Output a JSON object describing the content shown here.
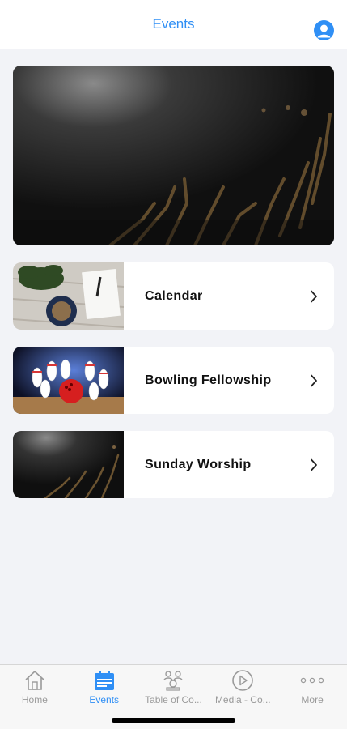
{
  "header": {
    "title": "Events",
    "profile_icon": "user-circle-icon"
  },
  "events": [
    {
      "label": "Calendar",
      "thumb_icon": "calendar-desk-photo"
    },
    {
      "label": "Bowling Fellowship",
      "thumb_icon": "bowling-photo"
    },
    {
      "label": "Sunday Worship",
      "thumb_icon": "worship-photo"
    }
  ],
  "tabs": [
    {
      "label": "Home",
      "icon": "home-icon",
      "active": false
    },
    {
      "label": "Events",
      "icon": "calendar-icon",
      "active": true
    },
    {
      "label": "Table of Co...",
      "icon": "people-table-icon",
      "active": false
    },
    {
      "label": "Media - Co...",
      "icon": "play-circle-icon",
      "active": false
    },
    {
      "label": "More",
      "icon": "more-dots-icon",
      "active": false
    }
  ],
  "colors": {
    "accent": "#2f8ff5",
    "inactive": "#9a9a9a",
    "background": "#f2f3f7"
  }
}
